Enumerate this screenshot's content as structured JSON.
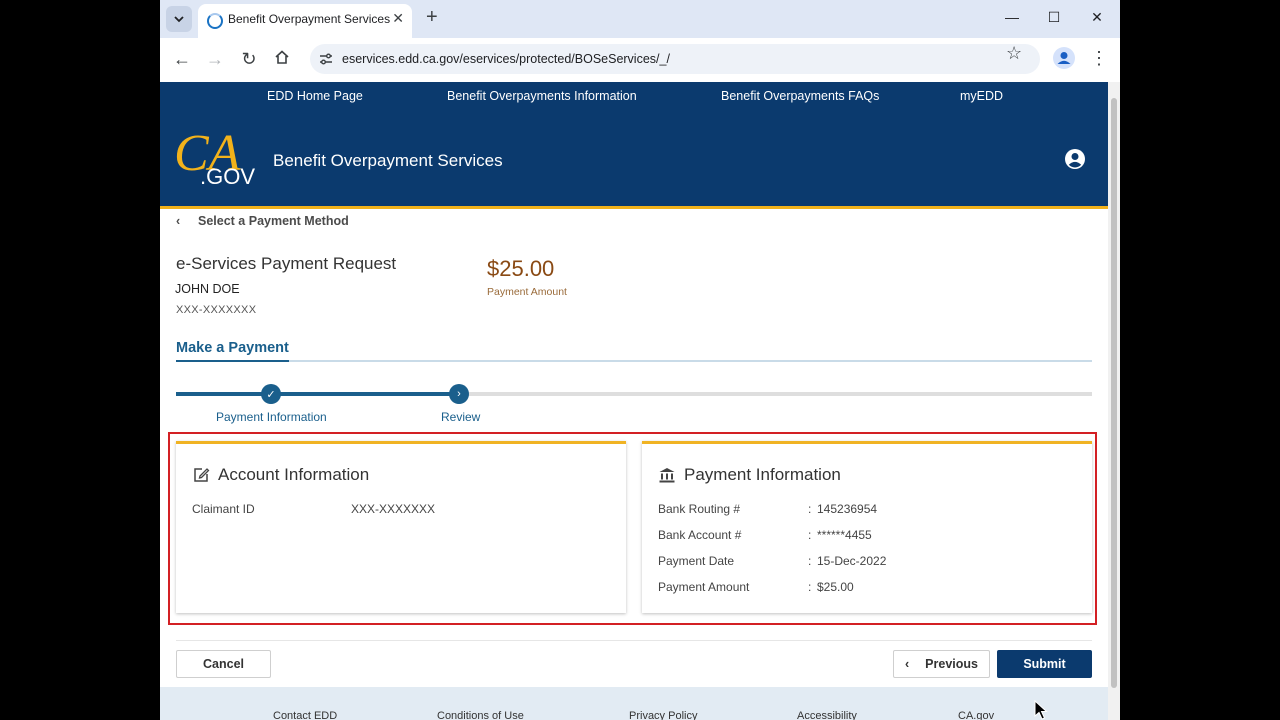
{
  "browser": {
    "tab_title": "Benefit Overpayment Services",
    "url": "eservices.edd.ca.gov/eservices/protected/BOSeServices/_/"
  },
  "topnav": {
    "items": [
      "EDD Home Page",
      "Benefit Overpayments Information",
      "Benefit Overpayments FAQs",
      "myEDD"
    ]
  },
  "header": {
    "logo_text_top": "CA",
    "logo_text_bottom": ".GOV",
    "site_title": "Benefit Overpayment Services"
  },
  "back_link": "Select a Payment Method",
  "request": {
    "title": "e-Services Payment Request",
    "name": "JOHN DOE",
    "id": "XXX-XXXXXXX",
    "amount": "$25.00",
    "amount_label": "Payment Amount"
  },
  "section": {
    "title": "Make a Payment"
  },
  "stepper": {
    "steps": [
      {
        "label": "Payment Information",
        "status": "complete"
      },
      {
        "label": "Review",
        "status": "current"
      }
    ]
  },
  "account_card": {
    "title": "Account Information",
    "icon": "edit-icon",
    "rows": [
      {
        "label": "Claimant ID",
        "value": "XXX-XXXXXXX"
      }
    ]
  },
  "payment_card": {
    "title": "Payment Information",
    "icon": "bank-icon",
    "rows": [
      {
        "label": "Bank Routing #",
        "value": "145236954"
      },
      {
        "label": "Bank Account #",
        "value": "******4455"
      },
      {
        "label": "Payment Date",
        "value": "15-Dec-2022"
      },
      {
        "label": "Payment Amount",
        "value": "$25.00"
      }
    ]
  },
  "separator": ":",
  "buttons": {
    "cancel": "Cancel",
    "previous": "Previous",
    "submit": "Submit"
  },
  "footer": {
    "links": [
      "Contact EDD",
      "Conditions of Use",
      "Privacy Policy",
      "Accessibility",
      "CA.gov"
    ]
  },
  "colors": {
    "header_blue": "#0b3a6e",
    "accent_gold": "#f2b21b",
    "amount_brown": "#8a4a14",
    "highlight_red": "#d32024",
    "step_blue": "#1a5f8c"
  }
}
